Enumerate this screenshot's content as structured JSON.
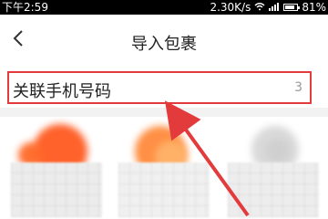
{
  "status_bar": {
    "time": "下午2:59",
    "network_speed": "2.30K/s",
    "battery_percent": "81%",
    "battery_level": 0.81,
    "icons": [
      "wifi-icon",
      "signal-icon",
      "battery-icon"
    ]
  },
  "header": {
    "title": "导入包裹",
    "back_icon": "chevron-left-icon"
  },
  "list": {
    "items": [
      {
        "label": "关联手机号码",
        "count": "3"
      }
    ]
  },
  "grid": {
    "cards": [
      {
        "name": "orange-card"
      },
      {
        "name": "orange-gradient-card",
        "foot": ""
      },
      {
        "name": "gray-card",
        "foot": ""
      }
    ]
  },
  "annotation": {
    "color": "#e33b3b"
  }
}
